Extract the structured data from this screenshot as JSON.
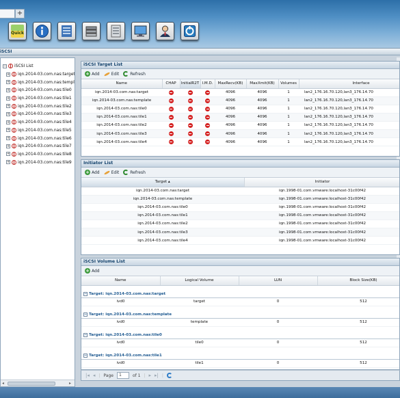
{
  "tabs": {
    "blank": "",
    "plus": "+"
  },
  "toolbar": [
    {
      "name": "quick-button",
      "icon": "quick-icon",
      "label": "Quick"
    },
    {
      "name": "info-button",
      "icon": "info-icon"
    },
    {
      "name": "network-button",
      "icon": "network-icon"
    },
    {
      "name": "storage-button",
      "icon": "disk-stack-icon"
    },
    {
      "name": "server-button",
      "icon": "server-icon"
    },
    {
      "name": "monitor-button",
      "icon": "monitor-icon"
    },
    {
      "name": "user-button",
      "icon": "user-icon"
    },
    {
      "name": "backup-button",
      "icon": "backup-icon"
    }
  ],
  "module": {
    "title": "iSCSI"
  },
  "tree": {
    "root_label": "iSCSI List",
    "items": [
      "iqn.2014-03.com.nas:target",
      "iqn.2014-03.com.nas:template",
      "iqn.2014-03.com.nas:tile0",
      "iqn.2014-03.com.nas:tile1",
      "iqn.2014-03.com.nas:tile2",
      "iqn.2014-03.com.nas:tile3",
      "iqn.2014-03.com.nas:tile4",
      "iqn.2014-03.com.nas:tile5",
      "iqn.2014-03.com.nas:tile6",
      "iqn.2014-03.com.nas:tile7",
      "iqn.2014-03.com.nas:tile8",
      "iqn.2014-03.com.nas:tile9"
    ]
  },
  "target_list": {
    "title": "iSCSI Target List",
    "add": "Add",
    "edit": "Edit",
    "refresh": "Refresh",
    "columns": [
      "Name",
      "CHAP",
      "InitialR2T",
      "I.M.D.",
      "MaxRecv(KB)",
      "MaxXmit(KB)",
      "Volumes",
      "Interface"
    ],
    "rows": [
      [
        "iqn.2014-03.com.nas:target",
        "4096",
        "4096",
        "1",
        "lan2_176.16.70.120,lan3_176.14.70"
      ],
      [
        "iqn.2014-03.com.nas:template",
        "4096",
        "4096",
        "1",
        "lan2_176.16.70.120,lan3_176.14.70"
      ],
      [
        "iqn.2014-03.com.nas:tile0",
        "4096",
        "4096",
        "1",
        "lan2_176.16.70.120,lan3_176.14.70"
      ],
      [
        "iqn.2014-03.com.nas:tile1",
        "4096",
        "4096",
        "1",
        "lan2_176.16.70.120,lan3_176.14.70"
      ],
      [
        "iqn.2014-03.com.nas:tile2",
        "4096",
        "4096",
        "1",
        "lan2_176.16.70.120,lan3_176.14.70"
      ],
      [
        "iqn.2014-03.com.nas:tile3",
        "4096",
        "4096",
        "1",
        "lan2_176.16.70.120,lan3_176.14.70"
      ],
      [
        "iqn.2014-03.com.nas:tile4",
        "4096",
        "4096",
        "1",
        "lan2_176.16.70.120,lan3_176.14.70"
      ]
    ]
  },
  "initiator_list": {
    "title": "Initiator List",
    "add": "Add",
    "edit": "Edit",
    "refresh": "Refresh",
    "columns": [
      "Target ▴",
      "Initiator"
    ],
    "rows": [
      [
        "iqn.2014-03.com.nas:target",
        "iqn.1998-01.com.vmware:localhost-31c00f42"
      ],
      [
        "iqn.2014-03.com.nas:template",
        "iqn.1998-01.com.vmware:localhost-31c00f42"
      ],
      [
        "iqn.2014-03.com.nas:tile0",
        "iqn.1998-01.com.vmware:localhost-31c00f42"
      ],
      [
        "iqn.2014-03.com.nas:tile1",
        "iqn.1998-01.com.vmware:localhost-31c00f42"
      ],
      [
        "iqn.2014-03.com.nas:tile2",
        "iqn.1998-01.com.vmware:localhost-31c00f42"
      ],
      [
        "iqn.2014-03.com.nas:tile3",
        "iqn.1998-01.com.vmware:localhost-31c00f42"
      ],
      [
        "iqn.2014-03.com.nas:tile4",
        "iqn.1998-01.com.vmware:localhost-31c00f42"
      ]
    ]
  },
  "volume_list": {
    "title": "iSCSI Volume List",
    "add": "Add",
    "columns": [
      "Name",
      "Logical Volume",
      "LUN",
      "Block Size(KB)"
    ],
    "groups": [
      {
        "label": "Target: iqn.2014-03.com.nas:target",
        "row": [
          "ivd0",
          "target",
          "0",
          "512"
        ]
      },
      {
        "label": "Target: iqn.2014-03.com.nas:template",
        "row": [
          "ivd0",
          "template",
          "0",
          "512"
        ]
      },
      {
        "label": "Target: iqn.2014-03.com.nas:tile0",
        "row": [
          "ivd0",
          "tile0",
          "0",
          "512"
        ]
      },
      {
        "label": "Target: iqn.2014-03.com.nas:tile1",
        "row": [
          "ivd0",
          "tile1",
          "0",
          "512"
        ]
      }
    ]
  },
  "pager": {
    "page_label": "Page",
    "page_value": "1",
    "of_label": "of 1"
  },
  "colors": {
    "accent": "#15436c",
    "stop": "#d42222",
    "header_band": "#4f8fc4"
  }
}
